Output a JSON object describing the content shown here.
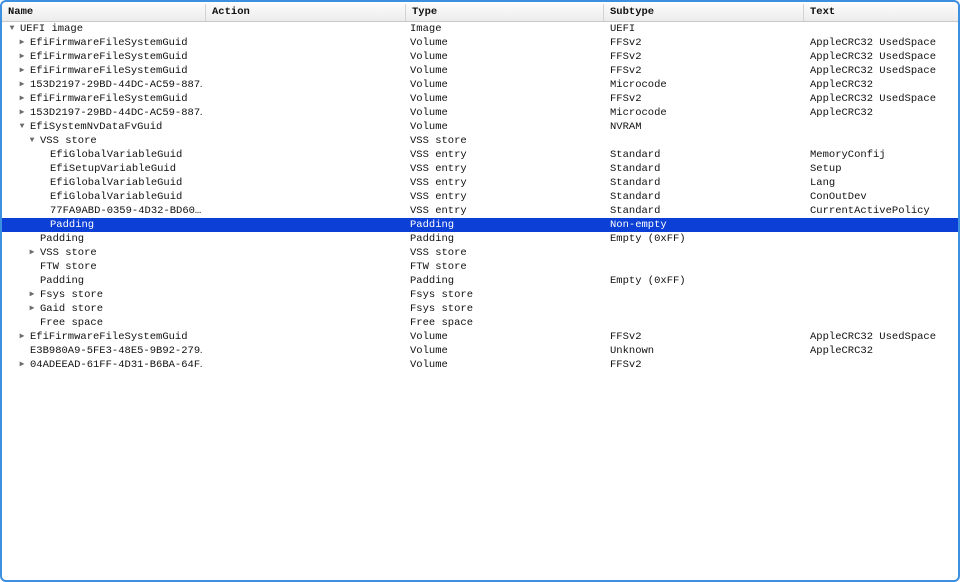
{
  "columns": [
    "Name",
    "Action",
    "Type",
    "Subtype",
    "Text"
  ],
  "selected_row": 14,
  "colors": {
    "selection": "#0b3fd6",
    "frame": "#3d8fe0"
  },
  "rows": [
    {
      "name": "UEFI image",
      "type": "Image",
      "subtype": "UEFI",
      "text": "",
      "level": 0,
      "expander": "expanded"
    },
    {
      "name": "EfiFirmwareFileSystemGuid",
      "type": "Volume",
      "subtype": "FFSv2",
      "text": "AppleCRC32 UsedSpace",
      "level": 1,
      "expander": "collapsed"
    },
    {
      "name": "EfiFirmwareFileSystemGuid",
      "type": "Volume",
      "subtype": "FFSv2",
      "text": "AppleCRC32 UsedSpace",
      "level": 1,
      "expander": "collapsed"
    },
    {
      "name": "EfiFirmwareFileSystemGuid",
      "type": "Volume",
      "subtype": "FFSv2",
      "text": "AppleCRC32 UsedSpace",
      "level": 1,
      "expander": "collapsed"
    },
    {
      "name": "153D2197-29BD-44DC-AC59-887…",
      "type": "Volume",
      "subtype": "Microcode",
      "text": "AppleCRC32",
      "level": 1,
      "expander": "collapsed"
    },
    {
      "name": "EfiFirmwareFileSystemGuid",
      "type": "Volume",
      "subtype": "FFSv2",
      "text": "AppleCRC32 UsedSpace",
      "level": 1,
      "expander": "collapsed"
    },
    {
      "name": "153D2197-29BD-44DC-AC59-887…",
      "type": "Volume",
      "subtype": "Microcode",
      "text": "AppleCRC32",
      "level": 1,
      "expander": "collapsed"
    },
    {
      "name": "EfiSystemNvDataFvGuid",
      "type": "Volume",
      "subtype": "NVRAM",
      "text": "",
      "level": 1,
      "expander": "expanded"
    },
    {
      "name": "VSS store",
      "type": "VSS store",
      "subtype": "",
      "text": "",
      "level": 2,
      "expander": "expanded"
    },
    {
      "name": "EfiGlobalVariableGuid",
      "type": "VSS entry",
      "subtype": "Standard",
      "text": "MemoryConfij",
      "level": 3,
      "expander": "none"
    },
    {
      "name": "EfiSetupVariableGuid",
      "type": "VSS entry",
      "subtype": "Standard",
      "text": "Setup",
      "level": 3,
      "expander": "none"
    },
    {
      "name": "EfiGlobalVariableGuid",
      "type": "VSS entry",
      "subtype": "Standard",
      "text": "Lang",
      "level": 3,
      "expander": "none"
    },
    {
      "name": "EfiGlobalVariableGuid",
      "type": "VSS entry",
      "subtype": "Standard",
      "text": "ConOutDev",
      "level": 3,
      "expander": "none"
    },
    {
      "name": "77FA9ABD-0359-4D32-BD60…",
      "type": "VSS entry",
      "subtype": "Standard",
      "text": "CurrentActivePolicy",
      "level": 3,
      "expander": "none"
    },
    {
      "name": "Padding",
      "type": "Padding",
      "subtype": "Non-empty",
      "text": "",
      "level": 3,
      "expander": "none"
    },
    {
      "name": "Padding",
      "type": "Padding",
      "subtype": "Empty (0xFF)",
      "text": "",
      "level": 2,
      "expander": "none"
    },
    {
      "name": "VSS store",
      "type": "VSS store",
      "subtype": "",
      "text": "",
      "level": 2,
      "expander": "collapsed"
    },
    {
      "name": "FTW store",
      "type": "FTW store",
      "subtype": "",
      "text": "",
      "level": 2,
      "expander": "none"
    },
    {
      "name": "Padding",
      "type": "Padding",
      "subtype": "Empty (0xFF)",
      "text": "",
      "level": 2,
      "expander": "none"
    },
    {
      "name": "Fsys store",
      "type": "Fsys store",
      "subtype": "",
      "text": "",
      "level": 2,
      "expander": "collapsed"
    },
    {
      "name": "Gaid store",
      "type": "Fsys store",
      "subtype": "",
      "text": "",
      "level": 2,
      "expander": "collapsed"
    },
    {
      "name": "Free space",
      "type": "Free space",
      "subtype": "",
      "text": "",
      "level": 2,
      "expander": "none"
    },
    {
      "name": "EfiFirmwareFileSystemGuid",
      "type": "Volume",
      "subtype": "FFSv2",
      "text": "AppleCRC32 UsedSpace",
      "level": 1,
      "expander": "collapsed"
    },
    {
      "name": "E3B980A9-5FE3-48E5-9B92-279…",
      "type": "Volume",
      "subtype": "Unknown",
      "text": "AppleCRC32",
      "level": 1,
      "expander": "none"
    },
    {
      "name": "04ADEEAD-61FF-4D31-B6BA-64F…",
      "type": "Volume",
      "subtype": "FFSv2",
      "text": "",
      "level": 1,
      "expander": "collapsed"
    }
  ]
}
